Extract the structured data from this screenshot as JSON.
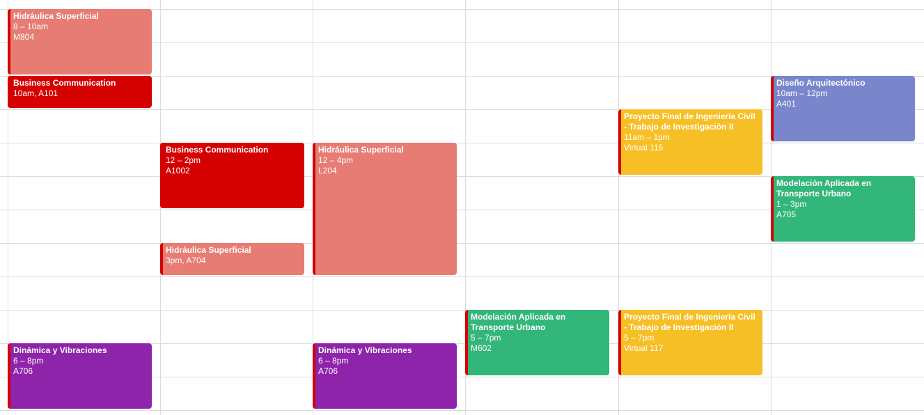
{
  "events": [
    {
      "title": "Hidráulica Superficial",
      "time": "8 – 10am",
      "room": "M804",
      "color": "#e67c73"
    },
    {
      "title": "Business Communication",
      "time": "10am, A101",
      "room": "",
      "color": "#d50000"
    },
    {
      "title": "Business Communication",
      "time": "12 – 2pm",
      "room": "A1002",
      "color": "#d50000"
    },
    {
      "title": "Hidráulica Superficial",
      "time": "3pm, A704",
      "room": "",
      "color": "#e67c73"
    },
    {
      "title": "Hidráulica Superficial",
      "time": "12 – 4pm",
      "room": "L204",
      "color": "#e67c73"
    },
    {
      "title": "Dinámica y Vibraciones",
      "time": "6 – 8pm",
      "room": "A706",
      "color": "#8e24aa"
    },
    {
      "title": "Dinámica y Vibraciones",
      "time": "6 – 8pm",
      "room": "A706",
      "color": "#8e24aa"
    },
    {
      "title": "Modelación Aplicada en Transporte Urbano",
      "time": "5 – 7pm",
      "room": "M602",
      "color": "#33b679"
    },
    {
      "title": "Proyecto Final de Ingeniería Civil - Trabajo de Investigación II",
      "time": "11am – 1pm",
      "room": "Virtual 115",
      "color": "#f6bf26"
    },
    {
      "title": "Proyecto Final de Ingeniería Civil - Trabajo de Investigación II",
      "time": "5 – 7pm",
      "room": "Virtual 117",
      "color": "#f6bf26"
    },
    {
      "title": "Diseño Arquitectónico",
      "time": "10am – 12pm",
      "room": "A401",
      "color": "#7986cb"
    },
    {
      "title": "Modelación Aplicada en Transporte Urbano",
      "time": "1 – 3pm",
      "room": "A705",
      "color": "#33b679"
    }
  ]
}
